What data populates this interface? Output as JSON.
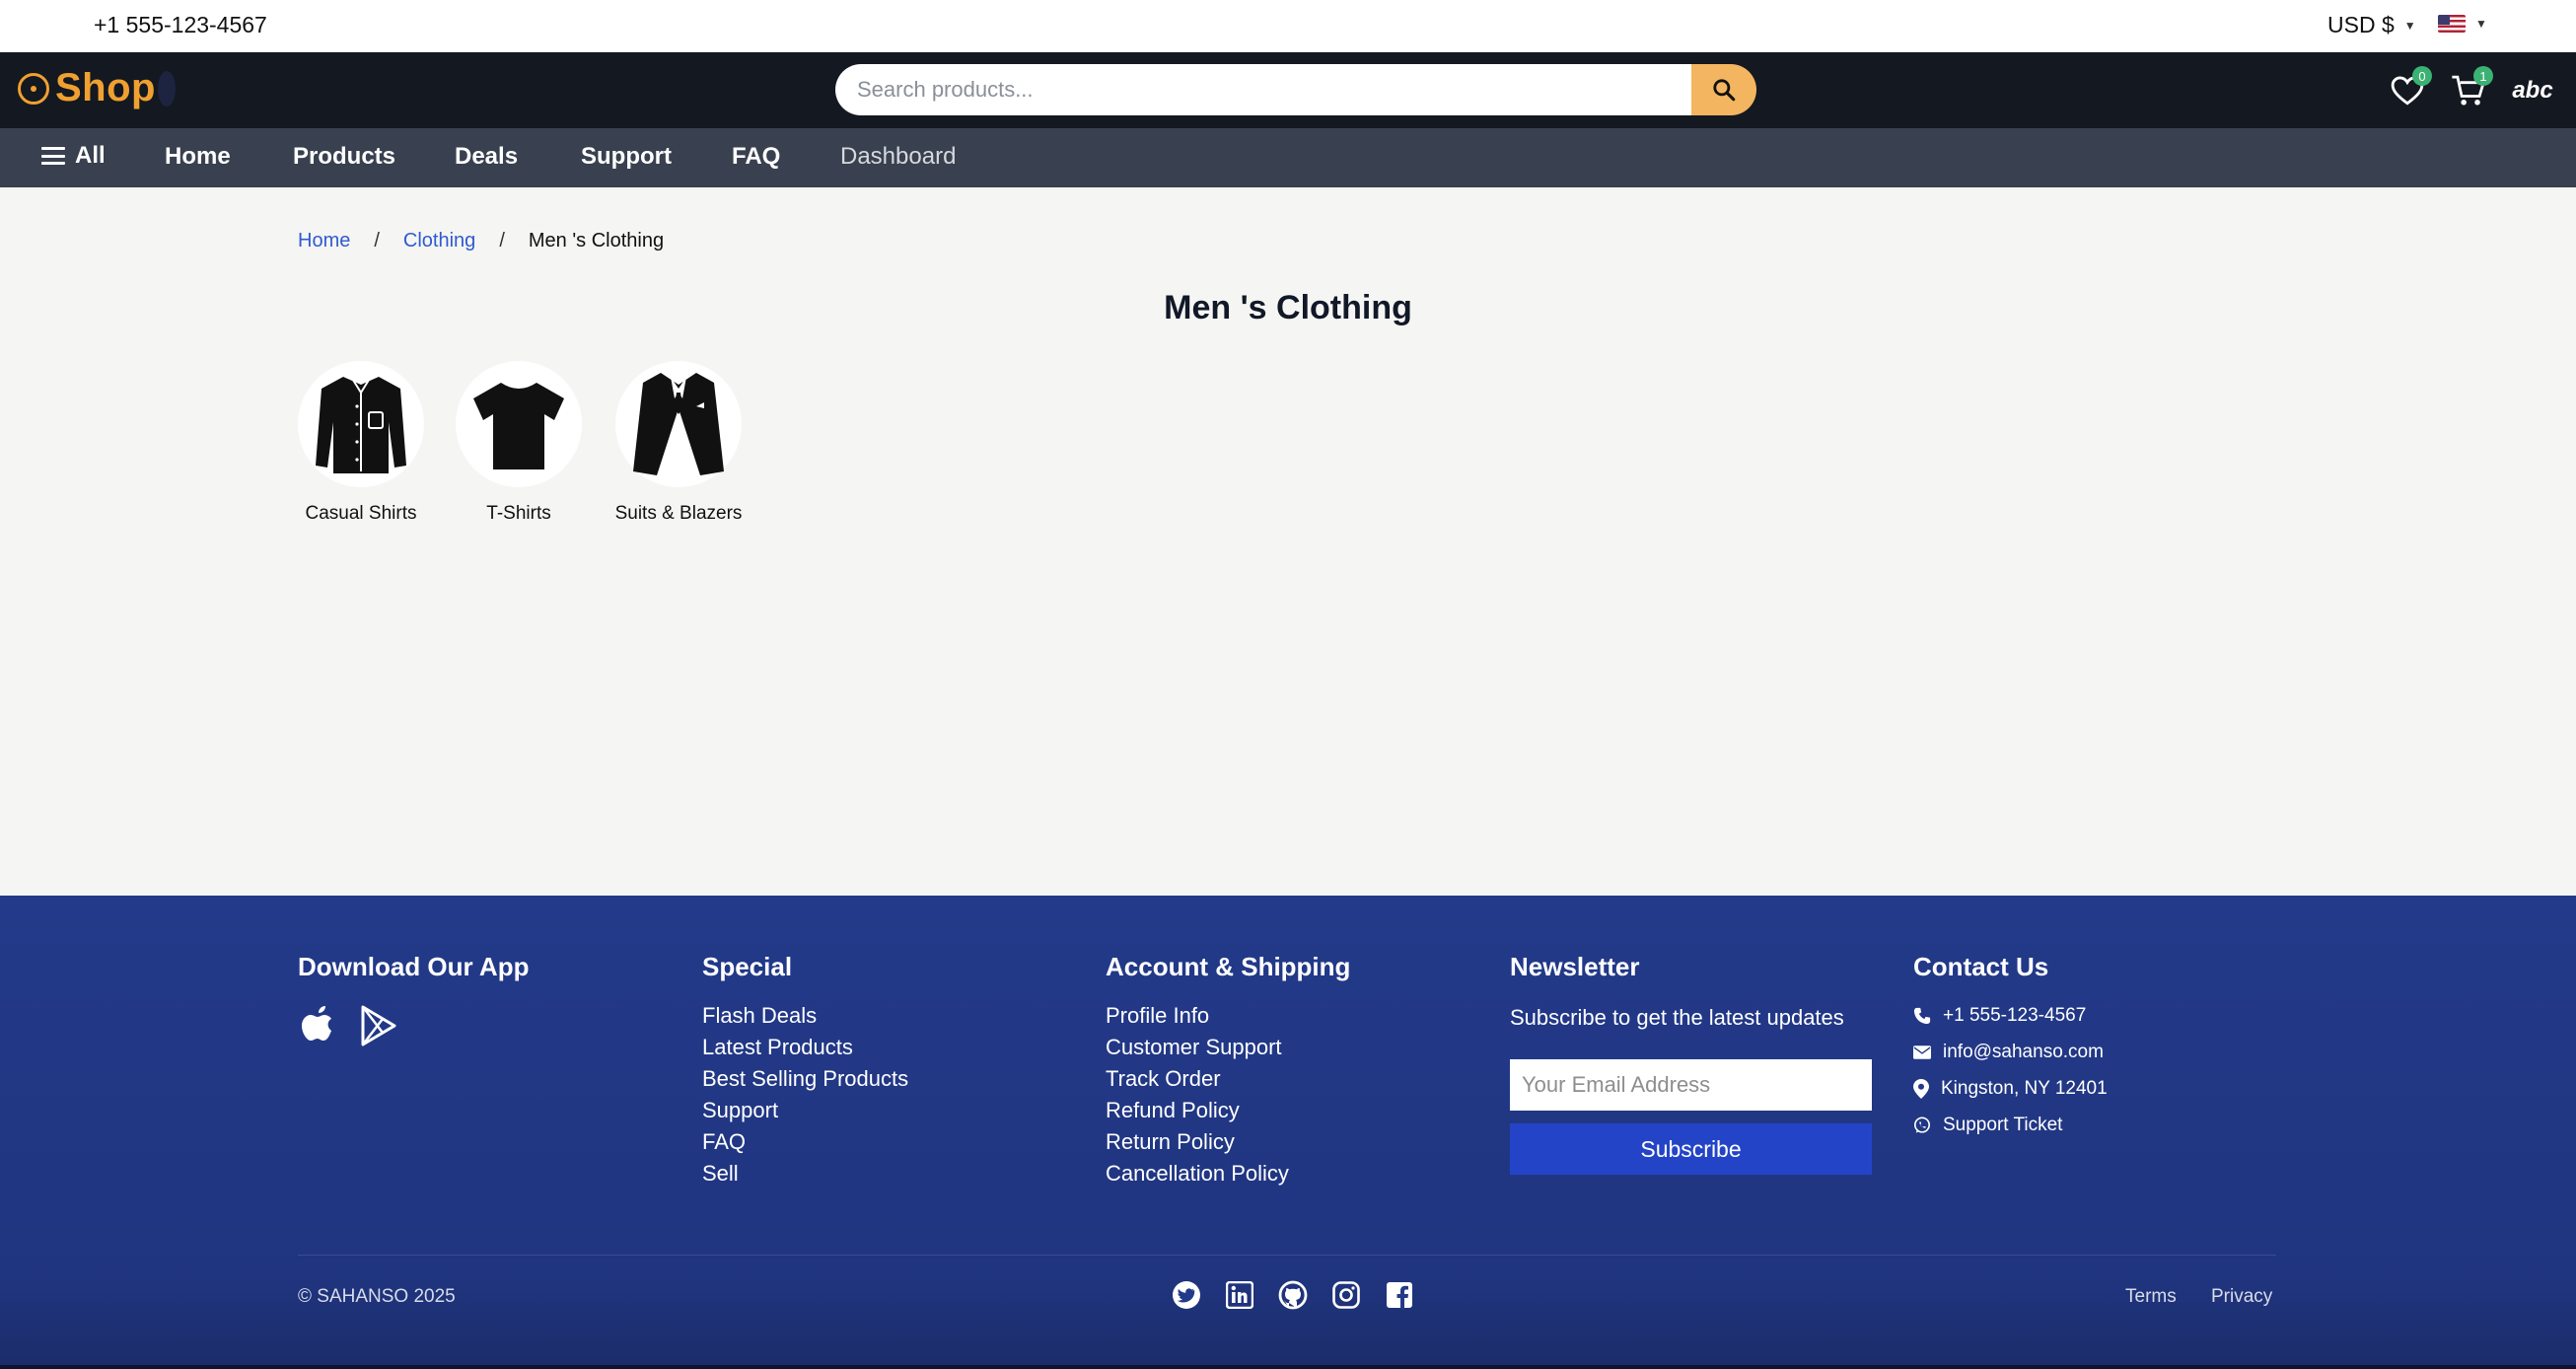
{
  "topbar": {
    "phone": "+1 555-123-4567",
    "currency": "USD $",
    "language_flag": "us-flag-icon"
  },
  "header": {
    "logo_text": "Shop",
    "search_placeholder": "Search products...",
    "wishlist_count": "0",
    "cart_count": "1",
    "account_label": "abc"
  },
  "nav": {
    "all_label": "All",
    "items": [
      "Home",
      "Products",
      "Deals",
      "Support",
      "FAQ",
      "Dashboard"
    ]
  },
  "breadcrumb": {
    "items": [
      "Home",
      "Clothing"
    ],
    "current": "Men 's Clothing",
    "separator": "/"
  },
  "page": {
    "title": "Men 's Clothing"
  },
  "categories": [
    {
      "label": "Casual Shirts",
      "icon": "casual-shirt-icon"
    },
    {
      "label": "T-Shirts",
      "icon": "tshirt-icon"
    },
    {
      "label": "Suits & Blazers",
      "icon": "suit-blazer-icon"
    }
  ],
  "footer": {
    "app": {
      "title": "Download Our App",
      "icons": [
        "apple-icon",
        "google-play-icon"
      ]
    },
    "special": {
      "title": "Special",
      "links": [
        "Flash Deals",
        "Latest Products",
        "Best Selling Products",
        "Support",
        "FAQ",
        "Sell"
      ]
    },
    "account": {
      "title": "Account & Shipping",
      "links": [
        "Profile Info",
        "Customer Support",
        "Track Order",
        "Refund Policy",
        "Return Policy",
        "Cancellation Policy"
      ]
    },
    "newsletter": {
      "title": "Newsletter",
      "description": "Subscribe to get the latest updates",
      "email_placeholder": "Your Email Address",
      "button": "Subscribe"
    },
    "contact": {
      "title": "Contact Us",
      "phone": "+1 555-123-4567",
      "email": "info@sahanso.com",
      "address": "Kingston, NY 12401",
      "ticket": "Support Ticket"
    },
    "copyright": "© SAHANSO 2025",
    "socials": [
      "twitter-icon",
      "linkedin-icon",
      "github-icon",
      "instagram-icon",
      "facebook-icon"
    ],
    "terms": "Terms",
    "privacy": "Privacy"
  },
  "colors": {
    "brand": "#f0a030",
    "header_bg": "#141821",
    "nav_bg": "#394150",
    "footer_bg": "#233a8a",
    "link": "#2f5bd0",
    "subscribe": "#2444c8",
    "badge": "#3bb273"
  }
}
